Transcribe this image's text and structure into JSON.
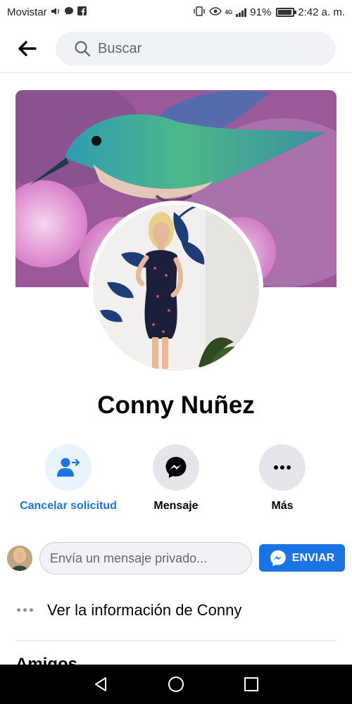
{
  "status_bar": {
    "carrier": "Movistar",
    "network": "4G",
    "battery": "91%",
    "time": "2:42 a. m."
  },
  "header": {
    "search_placeholder": "Buscar"
  },
  "profile": {
    "name": "Conny Nuñez"
  },
  "actions": {
    "cancel_request": "Cancelar solicitud",
    "message": "Mensaje",
    "more": "Más"
  },
  "message_bar": {
    "placeholder": "Envía un mensaje privado...",
    "send_label": "ENVIAR"
  },
  "info": {
    "see_info": "Ver la información de Conny"
  },
  "sections": {
    "friends": "Amigos"
  },
  "colors": {
    "accent": "#1b74e4",
    "accent_light": "#e7f3ff",
    "grey_button": "#e4e6eb"
  },
  "icons": {
    "back": "arrow-left-icon",
    "search": "search-icon",
    "cancel_request": "person-arrow-icon",
    "message": "messenger-icon",
    "more": "more-dots-icon",
    "send": "messenger-icon",
    "nav_back": "triangle-back-icon",
    "nav_home": "circle-home-icon",
    "nav_recents": "square-recents-icon"
  }
}
